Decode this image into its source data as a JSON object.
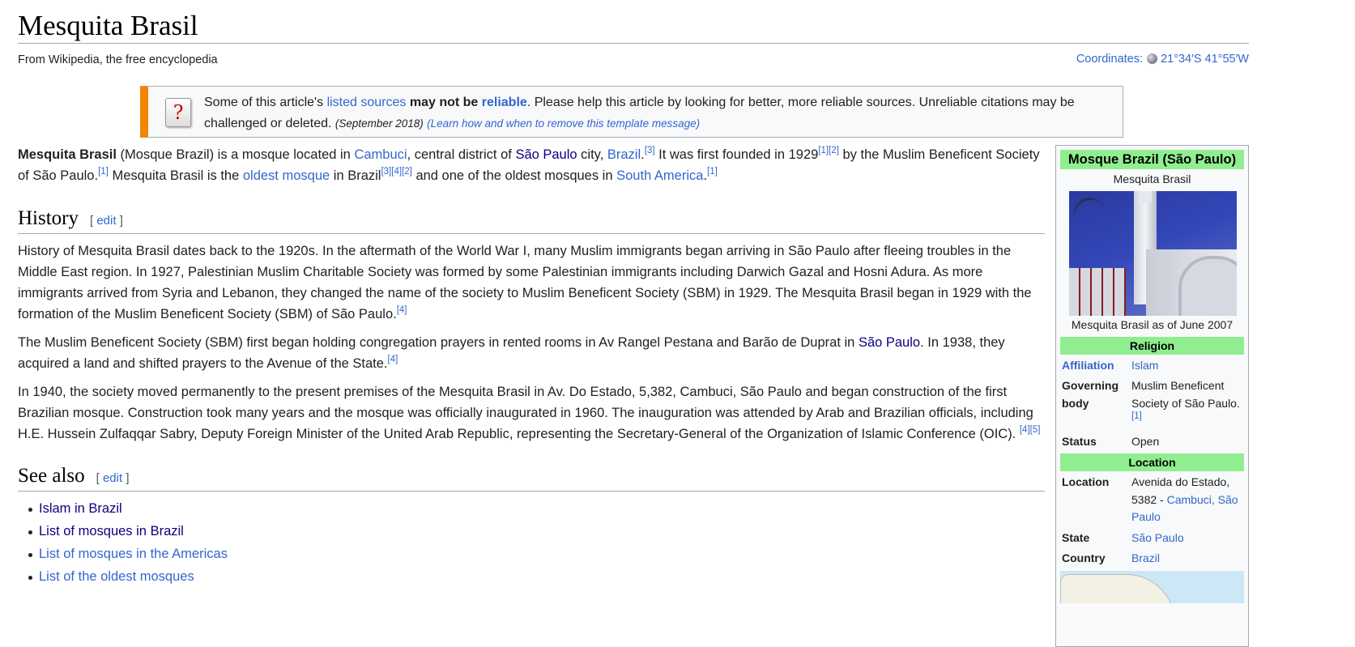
{
  "header": {
    "title": "Mesquita Brasil",
    "tagline": "From Wikipedia, the free encyclopedia",
    "coords_label": "Coordinates:",
    "coords_value": "21°34′S 41°55′W"
  },
  "notice": {
    "t1": "Some of this article's ",
    "link1": "listed sources",
    "bold": "may not be",
    "link2": "reliable",
    "t2": ". Please help this article by looking for better, more reliable sources. Unreliable citations may be challenged or deleted.",
    "date": "(September 2018)",
    "learn": "(Learn how and when to remove this template message)"
  },
  "lead": {
    "name": "Mesquita Brasil",
    "t1": " (Mosque Brazil) is a mosque located in ",
    "l_cambuci": "Cambuci",
    "t2": ", central district of ",
    "l_saopaulo": "São Paulo",
    "t3": " city, ",
    "l_brazil": "Brazil",
    "t4": ".",
    "r3": "[3]",
    "t5": " It was first founded in 1929",
    "r1": "[1]",
    "r2": "[2]",
    "t6": " by the Muslim Beneficent Society of São Paulo.",
    "r1b": "[1]",
    "t7": " Mesquita Brasil is the ",
    "l_oldest": "oldest mosque",
    "t8": " in Brazil",
    "r3b": "[3]",
    "r4": "[4]",
    "r2b": "[2]",
    "t9": " and one of the oldest mosques in ",
    "l_sa": "South America",
    "t10": ".",
    "r1c": "[1]"
  },
  "history": {
    "heading": "History",
    "edit": "edit",
    "p1": "History of Mesquita Brasil dates back to the 1920s. In the aftermath of the World War I, many Muslim immigrants began arriving in São Paulo after fleeing troubles in the Middle East region. In 1927, Palestinian Muslim Charitable Society was formed by some Palestinian immigrants including Darwich Gazal and Hosni Adura. As more immigrants arrived from Syria and Lebanon, they changed the name of the society to Muslim Beneficent Society (SBM) in 1929. The Mesquita Brasil began in 1929 with the formation of the Muslim Beneficent Society (SBM) of São Paulo.",
    "p1_ref": "[4]",
    "p2a": "The Muslim Beneficent Society (SBM) first began holding congregation prayers in rented rooms in Av Rangel Pestana and Barão de Duprat in ",
    "p2_link": "São Paulo",
    "p2b": ". In 1938, they acquired a land and shifted prayers to the Avenue of the State.",
    "p2_ref": "[4]",
    "p3": "In 1940, the society moved permanently to the present premises of the Mesquita Brasil in Av. Do Estado, 5,382, Cambuci, São Paulo and began construction of the first Brazilian mosque. Construction took many years and the mosque was officially inaugurated in 1960. The inauguration was attended by Arab and Brazilian officials, including H.E. Hussein Zulfaqqar Sabry, Deputy Foreign Minister of the United Arab Republic, representing the Secretary-General of the Organization of Islamic Conference (OIC). ",
    "p3_ref": "[4][5]"
  },
  "see_also": {
    "heading": "See also",
    "edit": "edit",
    "items": [
      "Islam in Brazil",
      "List of mosques in Brazil",
      "List of mosques in the Americas",
      "List of the oldest mosques"
    ]
  },
  "infobox": {
    "title": "Mosque Brazil (São Paulo)",
    "subtitle": "Mesquita Brasil",
    "caption": "Mesquita Brasil as of June 2007",
    "religion_header": "Religion",
    "affiliation_label": "Affiliation",
    "affiliation_value": "Islam",
    "governing_label": "Governing body",
    "governing_value": "Muslim Beneficent Society of São Paulo.",
    "governing_ref": "[1]",
    "status_label": "Status",
    "status_value": "Open",
    "location_header": "Location",
    "location_label": "Location",
    "location_value": "Avenida do Estado, 5382 - ",
    "location_link": "Cambuci, São Paulo",
    "state_label": "State",
    "state_value": "São Paulo",
    "country_label": "Country",
    "country_value": "Brazil"
  },
  "colors": {
    "link": "#3366cc",
    "visited_link": "#0b0080",
    "infobox_header": "#90ee90",
    "notice_stripe": "#f28500"
  }
}
